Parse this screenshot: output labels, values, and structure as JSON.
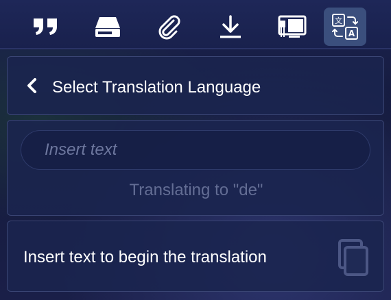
{
  "toolbar": {
    "buttons": [
      {
        "icon": "quote-icon"
      },
      {
        "icon": "drive-icon"
      },
      {
        "icon": "paperclip-icon"
      },
      {
        "icon": "download-icon"
      },
      {
        "icon": "monitor-icon"
      },
      {
        "icon": "translate-icon",
        "active": true
      }
    ]
  },
  "header": {
    "back_icon": "chevron-left-icon",
    "title": "Select Translation Language"
  },
  "input": {
    "placeholder": "Insert text",
    "value": "",
    "status": "Translating to \"de\""
  },
  "result": {
    "message": "Insert text to begin the translation",
    "copy_icon": "copy-icon"
  },
  "colors": {
    "panel_bg": "#1a244e",
    "active_button": "#3b4f7d",
    "text": "#ffffff",
    "muted_text": "#636d94"
  }
}
